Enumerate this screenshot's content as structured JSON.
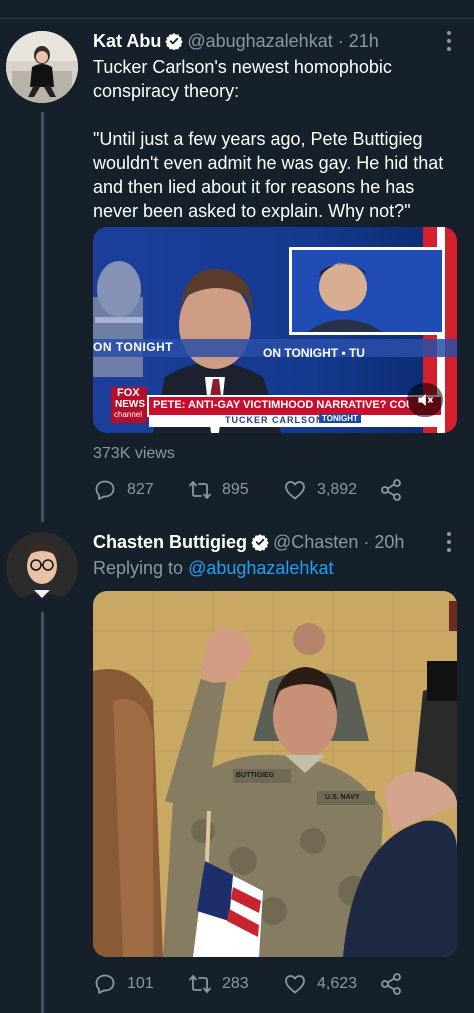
{
  "colors": {
    "background": "#15202b",
    "text_primary": "#ffffff",
    "text_secondary": "#8899a6",
    "link": "#1da1f2",
    "verified": "#ffffff",
    "thread_line": "#3d5466"
  },
  "tweets": [
    {
      "author_name": "Kat Abu",
      "handle": "@abughazalehkat",
      "time_sep": "·",
      "time": "21h",
      "text_line1": "Tucker Carlson's newest homophobic",
      "text_line2": "conspiracy theory:",
      "quote_line1": "\"Until just a few years ago, Pete Buttigieg",
      "quote_line2": "wouldn't even admit he was gay. He hid that",
      "quote_line3": "and then lied about it for reasons he has",
      "quote_line4": "never been asked to explain. Why not?\"",
      "media": {
        "lower_third_headline": "PETE: ANTI-GAY VICTIMHOOD NARRATIVE? COUNT ME",
        "lower_third_show": "TUCKER CARLSON",
        "lower_third_tonight": "TONIGHT",
        "banner_left": "ON TONIGHT",
        "banner_right": "ON TONIGHT  •  TU",
        "network_top": "FOX",
        "network_bottom": "NEWS",
        "network_sub": "channel"
      },
      "views": "373K views",
      "replies": "827",
      "retweets": "895",
      "likes": "3,892"
    },
    {
      "author_name": "Chasten Buttigieg",
      "handle": "@Chasten",
      "time_sep": "·",
      "time": "20h",
      "replying_prefix": "Replying to",
      "replying_handle": "@abughazalehkat",
      "media": {
        "name_tape": "BUTTIGIEG",
        "branch_tape": "U.S. NAVY"
      },
      "replies": "101",
      "retweets": "283",
      "likes": "4,623"
    }
  ],
  "icons": [
    "verified-badge-icon",
    "more-options-icon",
    "reply-icon",
    "retweet-icon",
    "like-icon",
    "share-icon",
    "mute-icon"
  ]
}
